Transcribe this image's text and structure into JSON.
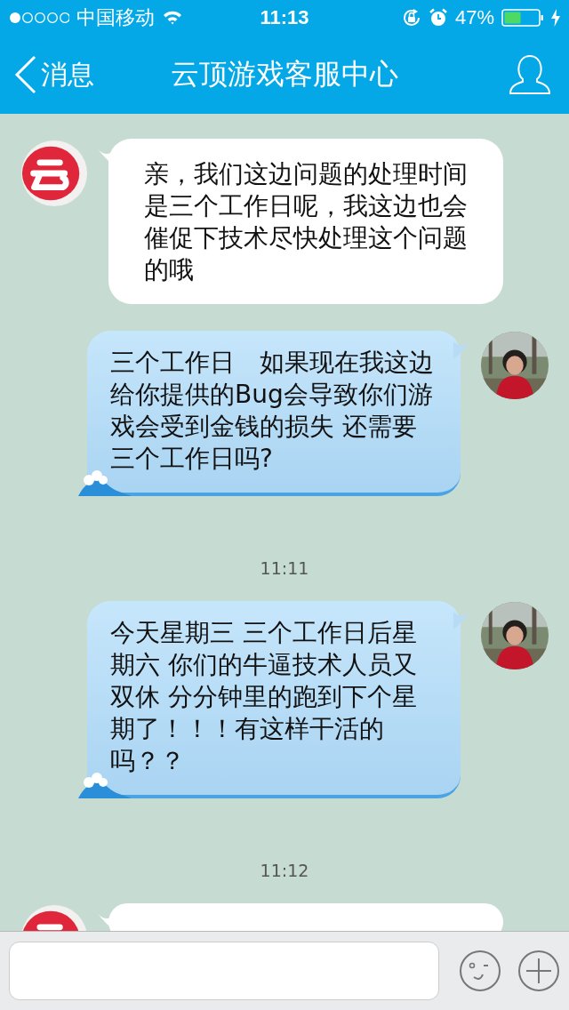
{
  "status_bar": {
    "carrier": "中国移动",
    "time": "11:13",
    "battery": "47%"
  },
  "nav": {
    "back": "消息",
    "title": "云顶游戏客服中心"
  },
  "messages": [
    {
      "kind": "incoming",
      "text": "亲，我们这边问题的处理时间是三个工作日呢，我这边也会催促下技术尽快处理这个问题的哦"
    },
    {
      "kind": "outgoing",
      "text": "三个工作日　如果现在我这边给你提供的Bug会导致你们游戏会受到金钱的损失  还需要三个工作日吗?"
    },
    {
      "kind": "time",
      "text": "11:11"
    },
    {
      "kind": "outgoing",
      "text": "今天星期三  三个工作日后星期六 你们的牛逼技术人员又双休  分分钟里的跑到下个星期了！！！有这样干活的吗？？"
    },
    {
      "kind": "time",
      "text": "11:12"
    },
    {
      "kind": "incoming"
    }
  ]
}
